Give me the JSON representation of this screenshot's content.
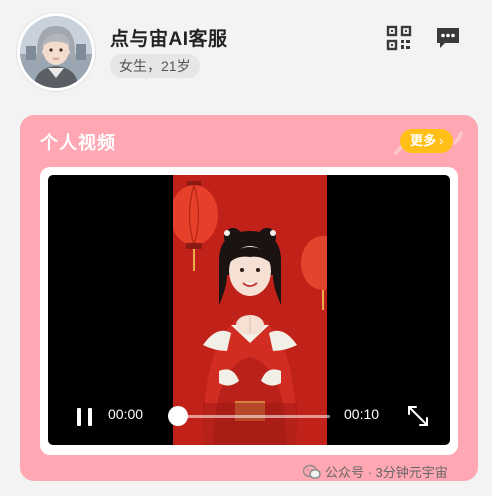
{
  "profile": {
    "name": "点与宙AI客服",
    "tag": "女生，21岁"
  },
  "header_icons": [
    "qr-code-icon",
    "chat-bubble-icon"
  ],
  "videos_section": {
    "title": "个人视频",
    "more_label": "更多",
    "more_chevron": "›"
  },
  "player": {
    "current_time": "00:00",
    "duration": "00:10",
    "progress": 0,
    "state": "paused"
  },
  "watermark": {
    "text": "公众号 · 3分钟元宇宙"
  },
  "colors": {
    "card_background": "#ffa7b2",
    "more_button": "#ffbf17",
    "video_background": "#c8241c"
  }
}
